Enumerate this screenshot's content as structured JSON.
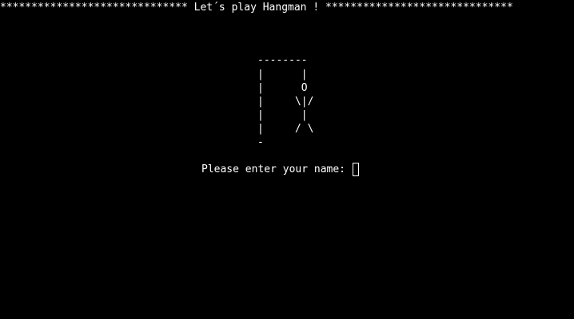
{
  "terminal": {
    "banner": "****************************** Let´s play Hangman ! ******************************",
    "gallows": [
      "--------",
      "|      |",
      "|      O",
      "|     \\|/",
      "|      |",
      "|     / \\",
      "-"
    ],
    "prompt": "Please enter your name: ",
    "input_value": ""
  },
  "colors": {
    "background": "#000000",
    "text": "#ffffff"
  }
}
